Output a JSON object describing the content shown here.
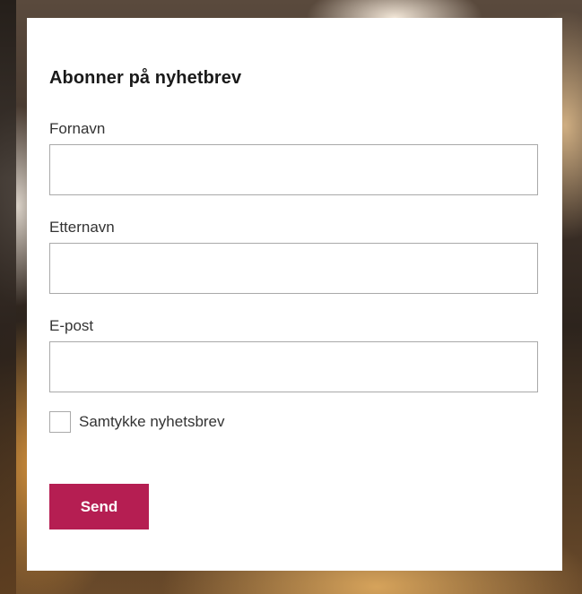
{
  "form": {
    "title": "Abonner på nyhetbrev",
    "fields": [
      {
        "label": "Fornavn",
        "value": "",
        "placeholder": ""
      },
      {
        "label": "Etternavn",
        "value": "",
        "placeholder": ""
      },
      {
        "label": "E-post",
        "value": "",
        "placeholder": ""
      }
    ],
    "consent": {
      "label": "Samtykke nyhetsbrev",
      "checked": false
    },
    "submit_label": "Send"
  },
  "colors": {
    "accent": "#b51e52",
    "card_background": "#ffffff",
    "border": "#a9a9a9",
    "text": "#333333"
  }
}
